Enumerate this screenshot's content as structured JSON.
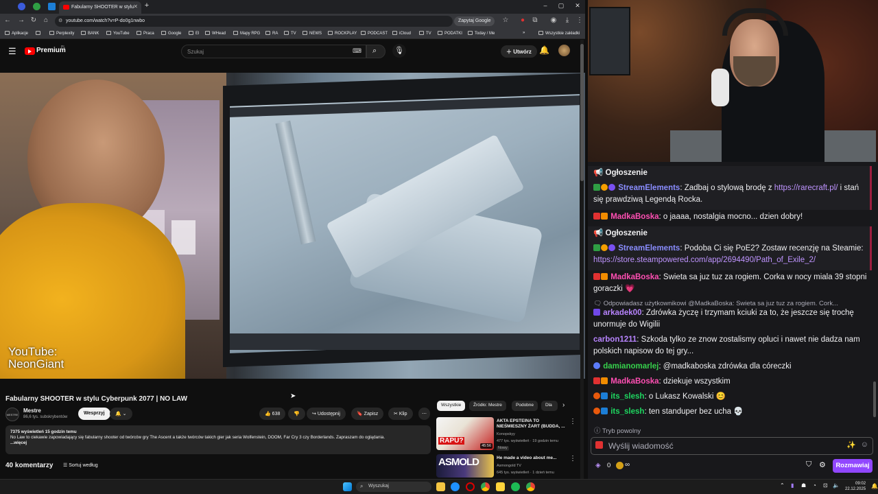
{
  "browser": {
    "tab_title": "Fabularny SHOOTER w stylu",
    "url": "youtube.com/watch?v=P-do0g1nwbo",
    "ask_google": "Zapytaj Google",
    "bookmarks": [
      "Aplikacje",
      "Perplexity",
      "BANK",
      "YouTube",
      "Praca",
      "Google",
      "El",
      "WHead",
      "Mapy RPG",
      "RA",
      "TV",
      "NEWS",
      "ROCKPLAY",
      "PODCAST",
      "iCloud",
      "TV",
      "PODATKI",
      "Today / Me"
    ],
    "all_bookmarks": "Wszystkie zakładki"
  },
  "youtube": {
    "logo": "Premium",
    "logo_region": "PL",
    "search_placeholder": "Szukaj",
    "create": "Utwórz",
    "watermark_line1": "YouTube:",
    "watermark_line2": "NeonGiant",
    "video_title": "Fabularny SHOOTER w stylu Cyberpunk 2077 | NO LAW",
    "channel_avatar": "MESTRE",
    "channel_name": "Mestre",
    "subscribers": "86,6 tys. subskrybentów",
    "join": "Wesprzyj",
    "likes": "638",
    "share": "Udostępnij",
    "save": "Zapisz",
    "clip": "Klip",
    "desc_stats": "7375 wyświetleń  15 godzin temu",
    "desc_text": "No Law to ciekawie zapowiadający się fabularny shooter od twórców gry The Ascent a także twórców takich gier jak seria Wolfenstein, DOOM, Far Cry 3 czy Borderlands. Zapraszam do oglądania.",
    "desc_more": "...więcej",
    "comments": "40 komentarzy",
    "sort": "Sortuj według",
    "chips": [
      "Wszystkie",
      "Źródło: Mestre",
      "Podobne",
      "Dla"
    ],
    "recs": [
      {
        "title": "AKTA EPSTEINA TO NIEŚMIESZNY ŻART (BUDDA, ...",
        "channel": "Konopskyy",
        "meta": "477 tys. wyświetleń · 19 godzin temu",
        "badge": "Nowy",
        "duration": "45:56",
        "thumb_text": "RAPU?"
      },
      {
        "title": "He made a video about me...",
        "channel": "Asmongold TV",
        "meta": "645 tys. wyświetleń · 1 dzień temu",
        "thumb_text": "ASMOLD"
      }
    ]
  },
  "chat": {
    "messages": [
      {
        "type": "announcement",
        "header": "Ogłoszenie",
        "user": "StreamElements",
        "user_color": "#8a8dff",
        "text": ": Zadbaj o stylową brodę z ",
        "link": "https://rarecraft.pl/",
        "text2": " i stań się prawdziwą Legendą Rocka."
      },
      {
        "type": "msg",
        "user": "MadkaBoska",
        "user_color": "#ff4fb3",
        "text": ": o jaaaa, nostalgia mocno... dzien dobry!"
      },
      {
        "type": "announcement",
        "header": "Ogłoszenie",
        "user": "StreamElements",
        "user_color": "#8a8dff",
        "text": ": Podoba Ci się PoE2? Zostaw recenzję na Steamie: ",
        "link": "https://store.steampowered.com/app/2694490/Path_of_Exile_2/",
        "text2": ""
      },
      {
        "type": "msg",
        "user": "MadkaBoska",
        "user_color": "#ff4fb3",
        "text": ": Swieta sa juz tuz za rogiem. Corka w nocy miala 39 stopni goraczki 💗"
      },
      {
        "type": "reply",
        "reply": "Odpowiadasz użytkownikowi @MadkaBoska: Swieta sa juz tuz za rogiem. Cork...",
        "user": "arkadek00",
        "user_color": "#b884ff",
        "text": ": Zdrówka życzę i trzymam kciuki za to, że jeszcze się trochę unormuje do Wigilii"
      },
      {
        "type": "msg",
        "user": "carbon1211",
        "user_color": "#b884ff",
        "text": ": Szkoda tylko ze znow zostalismy opluci i nawet nie dadza nam polskich napisow do tej gry..."
      },
      {
        "type": "msg",
        "user": "damianomarlej",
        "user_color": "#36d14c",
        "text": ": @madkaboska zdrówka dla córeczki"
      },
      {
        "type": "msg",
        "user": "MadkaBoska",
        "user_color": "#ff4fb3",
        "text": ": dziekuje wszystkim"
      },
      {
        "type": "msg",
        "user": "its_slesh",
        "user_color": "#1ed760",
        "text": ": o Lukasz Kowalski 😊"
      },
      {
        "type": "msg",
        "user": "its_slesh",
        "user_color": "#1ed760",
        "text": ": ten standuper bez ucha 💀"
      }
    ],
    "slow_mode": "Tryb powolny",
    "input_placeholder": "Wyślij wiadomość",
    "points": "0",
    "send": "Rozmawiaj"
  },
  "taskbar": {
    "search": "Wyszukaj",
    "time": "09:02",
    "date": "22.12.2025"
  }
}
